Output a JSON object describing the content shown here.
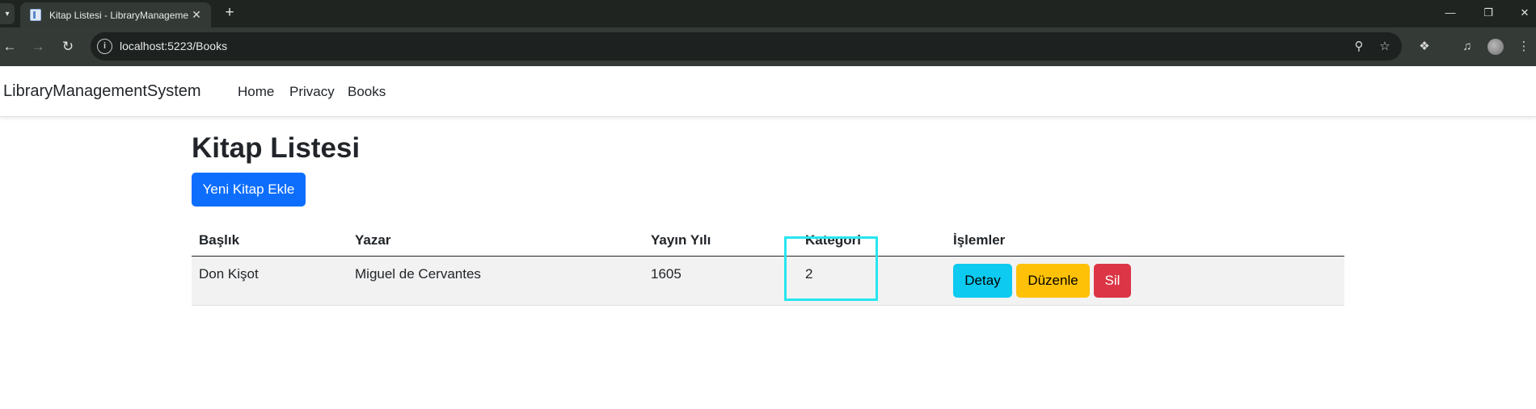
{
  "browser": {
    "tab_title": "Kitap Listesi - LibraryManageme",
    "url": "localhost:5223/Books"
  },
  "app": {
    "brand": "LibraryManagementSystem",
    "nav": [
      "Home",
      "Privacy",
      "Books"
    ]
  },
  "page": {
    "title": "Kitap Listesi",
    "add_button": "Yeni Kitap Ekle"
  },
  "table": {
    "headers": [
      "Başlık",
      "Yazar",
      "Yayın Yılı",
      "Kategori",
      "İşlemler"
    ],
    "rows": [
      {
        "title": "Don Kişot",
        "author": "Miguel de Cervantes",
        "year": "1605",
        "category": "2",
        "actions": [
          "Detay",
          "Düzenle",
          "Sil"
        ]
      }
    ]
  },
  "colors": {
    "primary": "#0d6efd",
    "info": "#0dcaf0",
    "warning": "#ffc107",
    "danger": "#dc3545",
    "highlight": "#27e6ee"
  }
}
